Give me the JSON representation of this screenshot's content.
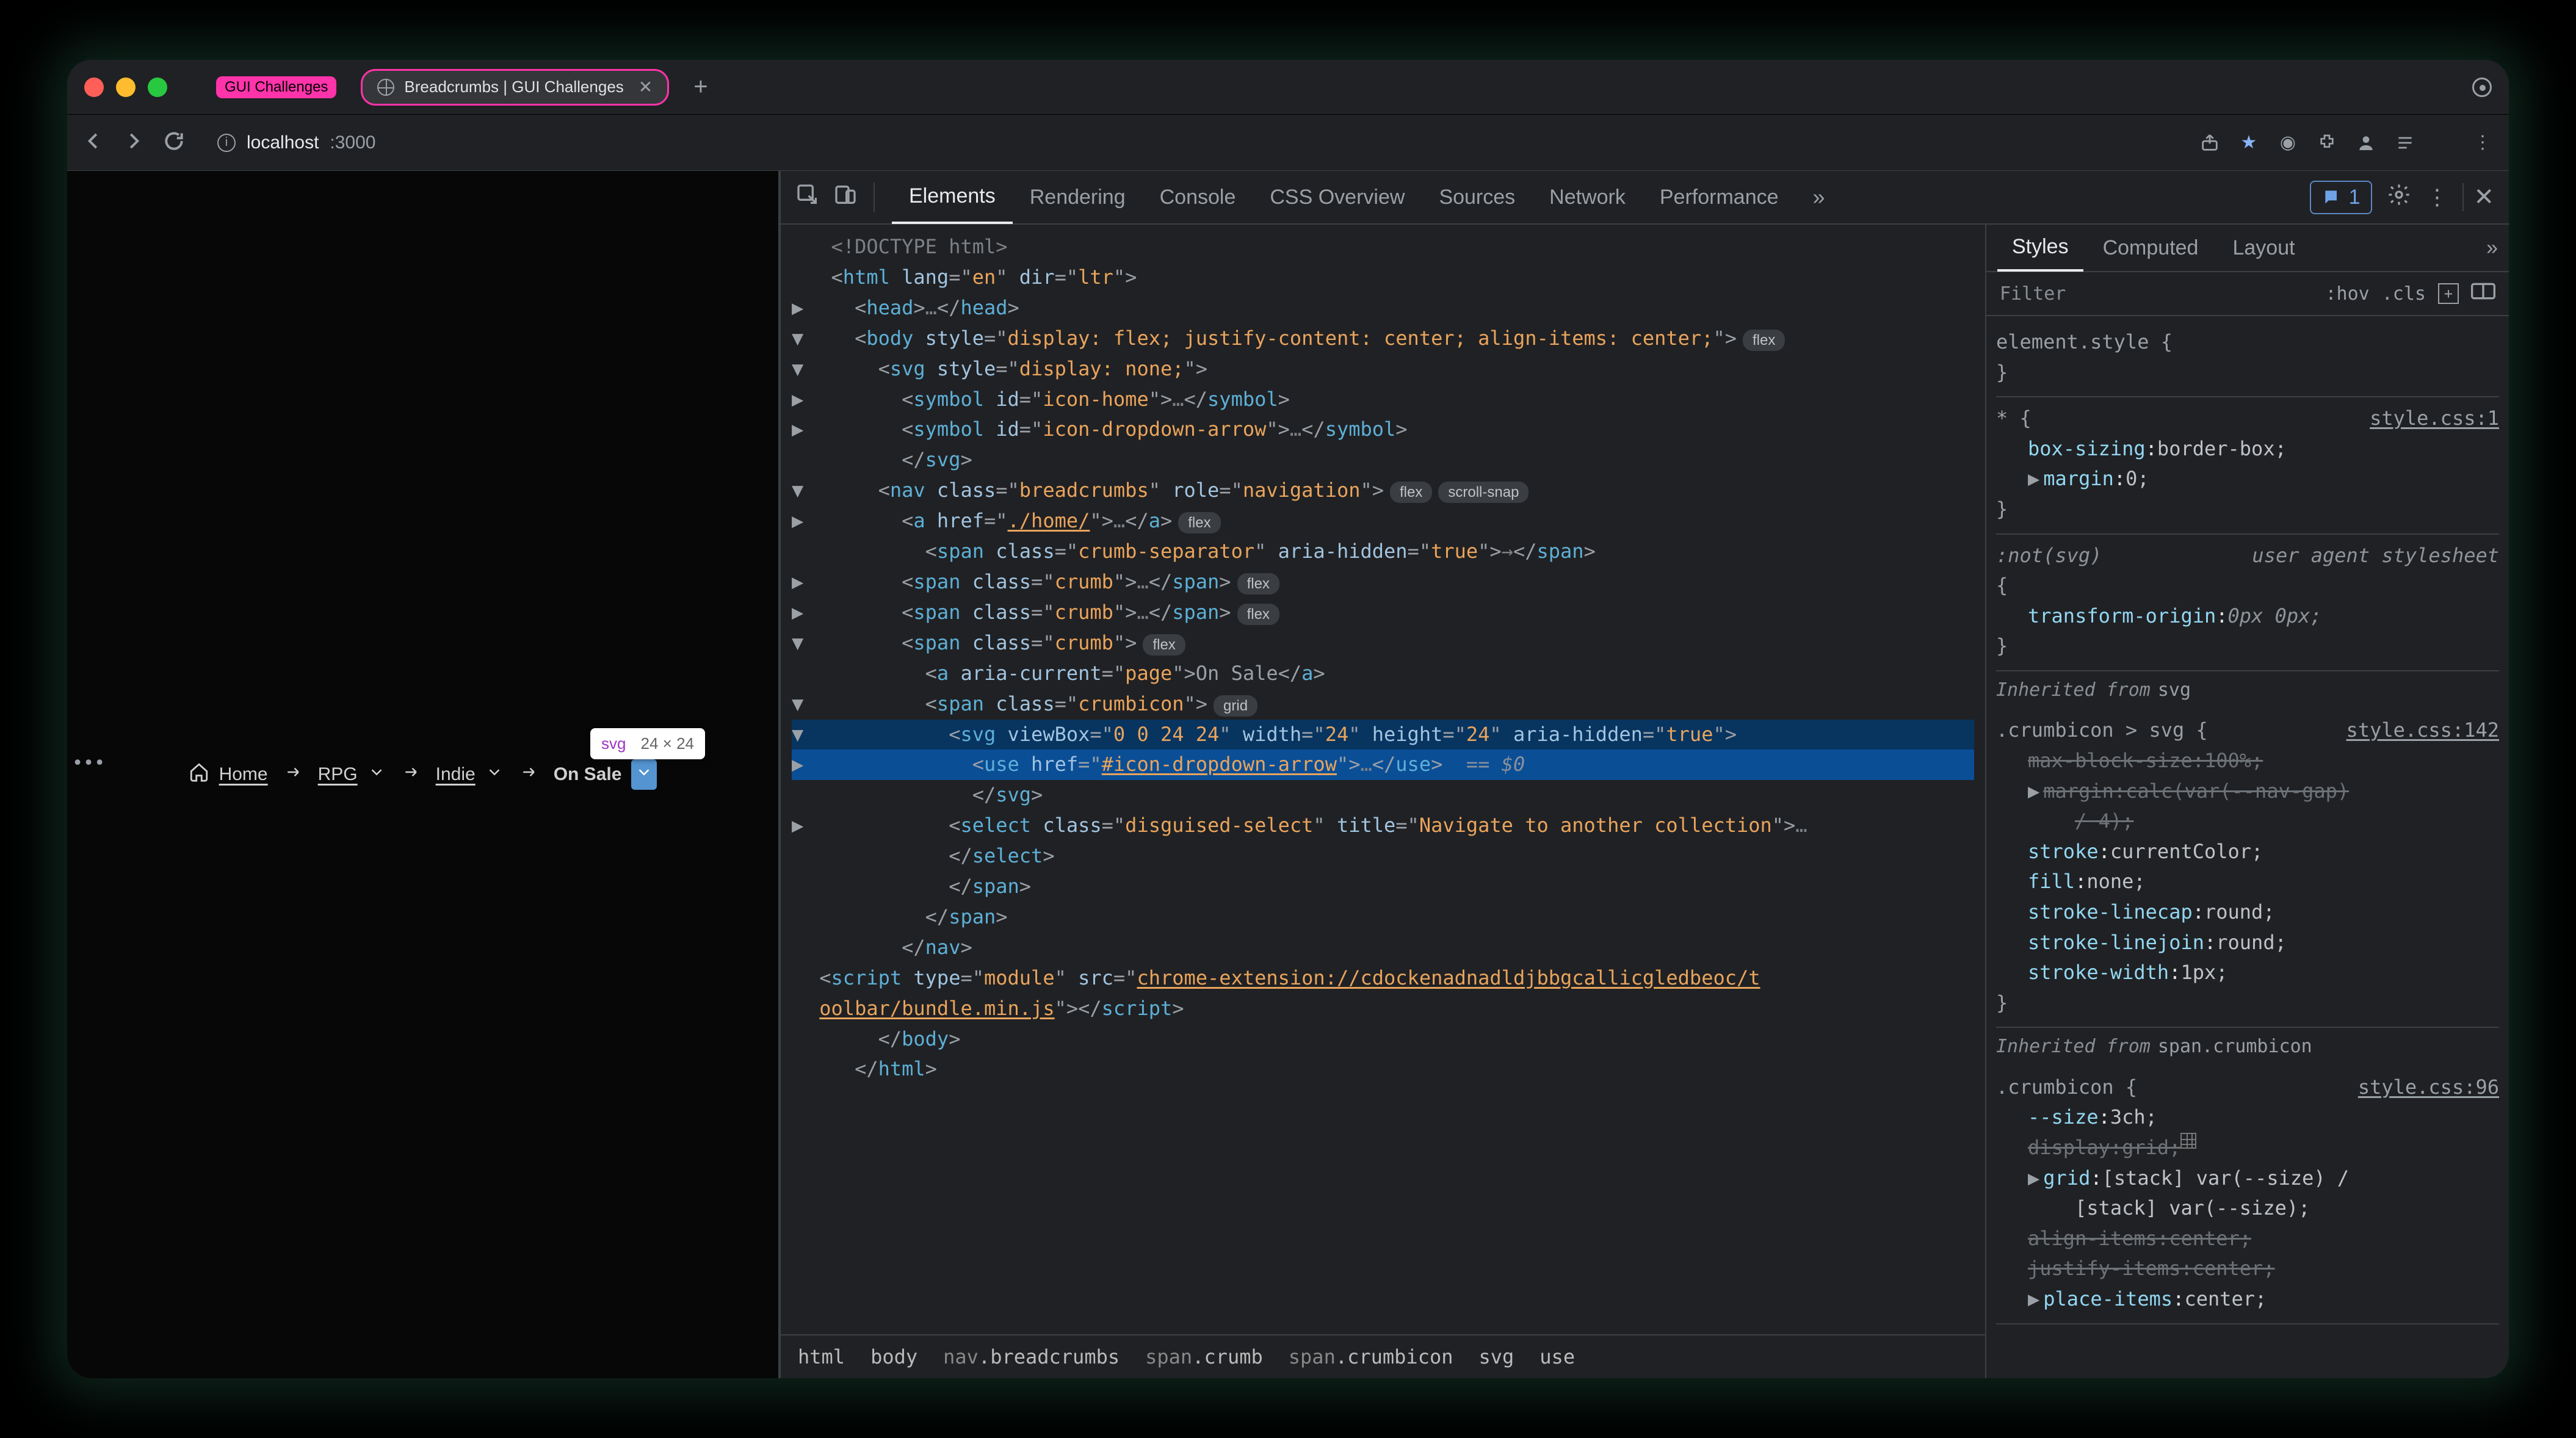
{
  "window": {
    "tabs": [
      {
        "label": "GUI Challenges",
        "pill": true
      },
      {
        "label": "Breadcrumbs | GUI Challenges",
        "active": true
      }
    ],
    "url": {
      "host": "localhost",
      "port": ":3000"
    }
  },
  "tooltip": {
    "tag": "svg",
    "dims": "24 × 24"
  },
  "breadcrumbs": {
    "home": "Home",
    "items": [
      "RPG",
      "Indie"
    ],
    "current": "On Sale"
  },
  "devtools": {
    "tabs": [
      "Elements",
      "Rendering",
      "Console",
      "CSS Overview",
      "Sources",
      "Network",
      "Performance"
    ],
    "active": "Elements",
    "issues": "1",
    "styles_tabs": [
      "Styles",
      "Computed",
      "Layout"
    ],
    "styles_active": "Styles",
    "filter_placeholder": "Filter",
    "filter_hov": ":hov",
    "filter_cls": ".cls"
  },
  "dom": {
    "lines": [
      {
        "indent": 0,
        "tw": "",
        "raw": "<!DOCTYPE html>"
      },
      {
        "indent": 0,
        "tw": "",
        "open": "html",
        "attrs": [
          [
            "lang",
            "en"
          ],
          [
            "dir",
            "ltr"
          ]
        ]
      },
      {
        "indent": 1,
        "tw": "▶",
        "open": "head",
        "mid": "…",
        "close": "head"
      },
      {
        "indent": 1,
        "tw": "▼",
        "open": "body",
        "attrs": [
          [
            "style",
            "display: flex; justify-content: center; align-items: center;"
          ]
        ],
        "badges": [
          "flex"
        ]
      },
      {
        "indent": 2,
        "tw": "▼",
        "open": "svg",
        "attrs": [
          [
            "style",
            "display: none;"
          ]
        ]
      },
      {
        "indent": 3,
        "tw": "▶",
        "open": "symbol",
        "attrs": [
          [
            "id",
            "icon-home"
          ]
        ],
        "mid": "…",
        "close": "symbol"
      },
      {
        "indent": 3,
        "tw": "▶",
        "open": "symbol",
        "attrs": [
          [
            "id",
            "icon-dropdown-arrow"
          ]
        ],
        "mid": "…",
        "close": "symbol"
      },
      {
        "indent": 3,
        "tw": "",
        "closeonly": "svg"
      },
      {
        "indent": 2,
        "tw": "▼",
        "open": "nav",
        "attrs": [
          [
            "class",
            "breadcrumbs"
          ],
          [
            "role",
            "navigation"
          ]
        ],
        "badges": [
          "flex",
          "scroll-snap"
        ]
      },
      {
        "indent": 3,
        "tw": "▶",
        "open": "a",
        "attrs": [
          [
            "href",
            "./home/",
            "link"
          ]
        ],
        "mid": "…",
        "close": "a",
        "badges": [
          "flex"
        ]
      },
      {
        "indent": 4,
        "tw": "",
        "open": "span",
        "attrs": [
          [
            "class",
            "crumb-separator"
          ],
          [
            "aria-hidden",
            "true"
          ]
        ],
        "mid": "→",
        "close": "span"
      },
      {
        "indent": 3,
        "tw": "▶",
        "open": "span",
        "attrs": [
          [
            "class",
            "crumb"
          ]
        ],
        "mid": "…",
        "close": "span",
        "badges": [
          "flex"
        ]
      },
      {
        "indent": 3,
        "tw": "▶",
        "open": "span",
        "attrs": [
          [
            "class",
            "crumb"
          ]
        ],
        "mid": "…",
        "close": "span",
        "badges": [
          "flex"
        ]
      },
      {
        "indent": 3,
        "tw": "▼",
        "open": "span",
        "attrs": [
          [
            "class",
            "crumb"
          ]
        ],
        "badges": [
          "flex"
        ]
      },
      {
        "indent": 4,
        "tw": "",
        "open": "a",
        "attrs": [
          [
            "aria-current",
            "page"
          ]
        ],
        "mid": "On Sale",
        "close": "a"
      },
      {
        "indent": 4,
        "tw": "▼",
        "open": "span",
        "attrs": [
          [
            "class",
            "crumbicon"
          ]
        ],
        "badges": [
          "grid"
        ]
      },
      {
        "indent": 5,
        "tw": "▼",
        "open": "svg",
        "attrs": [
          [
            "viewBox",
            "0 0 24 24"
          ],
          [
            "width",
            "24"
          ],
          [
            "height",
            "24"
          ],
          [
            "aria-hidden",
            "true"
          ]
        ],
        "selctx": true
      },
      {
        "indent": 6,
        "tw": "▶",
        "open": "use",
        "attrs": [
          [
            "href",
            "#icon-dropdown-arrow",
            "link"
          ]
        ],
        "mid": "…",
        "close": "use",
        "eq0": true,
        "sel": true,
        "dots": true
      },
      {
        "indent": 6,
        "tw": "",
        "closeonly": "svg"
      },
      {
        "indent": 5,
        "tw": "▶",
        "open": "select",
        "attrs": [
          [
            "class",
            "disguised-select"
          ],
          [
            "title",
            "Navigate to another collection"
          ]
        ],
        "mid": "…"
      },
      {
        "indent": 5,
        "tw": "",
        "closeonly": "select"
      },
      {
        "indent": 5,
        "tw": "",
        "closeonly": "span"
      },
      {
        "indent": 4,
        "tw": "",
        "closeonly": "span"
      },
      {
        "indent": 3,
        "tw": "",
        "closeonly": "nav"
      },
      {
        "indent": 3,
        "tw": "",
        "open": "script",
        "attrs": [
          [
            "type",
            "module"
          ],
          [
            "src",
            "chrome-extension://cdockenadnadldjbbgcallicgledbeoc/toolbar/bundle.min.js",
            "link"
          ]
        ],
        "close": "script",
        "wrap": true
      },
      {
        "indent": 2,
        "tw": "",
        "closeonly": "body"
      },
      {
        "indent": 1,
        "tw": "",
        "closeonly": "html"
      }
    ],
    "crumbs": [
      {
        "t": "html"
      },
      {
        "t": "body"
      },
      {
        "pre": "nav",
        "suf": ".breadcrumbs"
      },
      {
        "pre": "span",
        "suf": ".crumb"
      },
      {
        "pre": "span",
        "suf": ".crumbicon"
      },
      {
        "t": "svg"
      },
      {
        "t": "use"
      }
    ]
  },
  "styles": {
    "rules": [
      {
        "sel": "element.style {",
        "props": [],
        "close": "}"
      },
      {
        "sel": "* {",
        "src": "style.css:1",
        "props": [
          {
            "n": "box-sizing",
            "v": "border-box;"
          },
          {
            "n": "margin",
            "v": "0;",
            "tri": true
          }
        ],
        "close": "}"
      },
      {
        "sel": ":not(svg)",
        "ua": "user agent stylesheet",
        "open": "{",
        "props": [
          {
            "n": "transform-origin",
            "v": "0px 0px;",
            "ital": true
          }
        ],
        "close": "}",
        "italic": true
      },
      {
        "section": "Inherited from",
        "sectionMono": "svg"
      },
      {
        "sel": ".crumbicon > svg {",
        "src": "style.css:142",
        "props": [
          {
            "n": "max-block-size",
            "v": "100%;",
            "strike": true
          },
          {
            "n": "margin",
            "v": "calc(var(--nav-gap)",
            "tri": true,
            "strike": true,
            "cont": "/ 4);"
          },
          {
            "n": "stroke",
            "v": "currentColor;"
          },
          {
            "n": "fill",
            "v": "none;"
          },
          {
            "n": "stroke-linecap",
            "v": "round;"
          },
          {
            "n": "stroke-linejoin",
            "v": "round;"
          },
          {
            "n": "stroke-width",
            "v": "1px;"
          }
        ],
        "close": "}"
      },
      {
        "section": "Inherited from",
        "sectionMono": "span.crumbicon"
      },
      {
        "sel": ".crumbicon {",
        "src": "style.css:96",
        "props": [
          {
            "n": "--size",
            "v": "3ch;"
          },
          {
            "n": "display",
            "v": "grid;",
            "strike": true,
            "gridic": true
          },
          {
            "n": "grid",
            "v": "[stack] var(--size) /",
            "tri": true,
            "cont": "[stack] var(--size);"
          },
          {
            "n": "align-items",
            "v": "center;",
            "strike": true
          },
          {
            "n": "justify-items",
            "v": "center;",
            "strike": true
          },
          {
            "n": "place-items",
            "v": "center;",
            "tri": true
          }
        ]
      }
    ]
  }
}
